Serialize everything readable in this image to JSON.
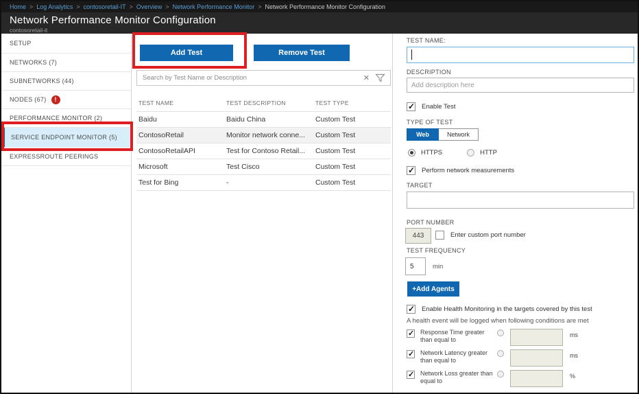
{
  "breadcrumb": {
    "separator": ">",
    "items": [
      "Home",
      "Log Analytics",
      "contosoretail-IT",
      "Overview",
      "Network Performance Monitor",
      "Network Performance Monitor Configuration"
    ]
  },
  "header": {
    "title": "Network Performance Monitor Configuration",
    "subtitle": "contosoretail-it"
  },
  "sidebar": {
    "items": [
      {
        "label": "SETUP"
      },
      {
        "label": "NETWORKS (7)"
      },
      {
        "label": "SUBNETWORKS (44)"
      },
      {
        "label": "NODES (67)",
        "badge": "!"
      },
      {
        "label": "PERFORMANCE MONITOR (2)"
      },
      {
        "label": "SERVICE ENDPOINT MONITOR (5)",
        "selected": true
      },
      {
        "label": "EXPRESSROUTE PEERINGS"
      }
    ]
  },
  "tests_panel": {
    "add_button": "Add Test",
    "remove_button": "Remove Test",
    "search_placeholder": "Search by Test Name or Description",
    "clear_icon": "✕",
    "table": {
      "columns": [
        "TEST NAME",
        "TEST DESCRIPTION",
        "TEST TYPE"
      ],
      "rows": [
        {
          "name": "Baidu",
          "description": "Baidu China",
          "type": "Custom Test"
        },
        {
          "name": "ContosoRetail",
          "description": "Monitor network conne...",
          "type": "Custom Test"
        },
        {
          "name": "ContosoRetailAPI",
          "description": "Test for Contoso Retail...",
          "type": "Custom Test"
        },
        {
          "name": "Microsoft",
          "description": "Test Cisco",
          "type": "Custom Test"
        },
        {
          "name": "Test for Bing",
          "description": "-",
          "type": "Custom Test"
        }
      ]
    }
  },
  "form": {
    "test_name_label": "TEST NAME:",
    "description_label": "DESCRIPTION",
    "description_placeholder": "Add description here",
    "enable_test_label": "Enable Test",
    "type_of_test_label": "TYPE OF TEST",
    "type_web": "Web",
    "type_network": "Network",
    "type_selected": "Web",
    "protocol_https": "HTTPS",
    "protocol_http": "HTTP",
    "protocol_selected": "HTTPS",
    "perform_measurements_label": "Perform network measurements",
    "target_label": "TARGET",
    "port_label": "PORT NUMBER",
    "port_value": "443",
    "custom_port_label": "Enter custom port number",
    "frequency_label": "TEST FREQUENCY",
    "frequency_value": "5",
    "frequency_unit": "min",
    "add_agents_button": "+Add Agents",
    "health_monitoring_label": "Enable Health Monitoring in the targets covered by this test",
    "health_note": "A health event will be logged when following conditions are met",
    "conditions": [
      {
        "label": "Response Time greater than equal to",
        "unit": "ms"
      },
      {
        "label": "Network Latency greater than equal to",
        "unit": "ms"
      },
      {
        "label": "Network Loss greater than equal to",
        "unit": "%"
      }
    ]
  }
}
